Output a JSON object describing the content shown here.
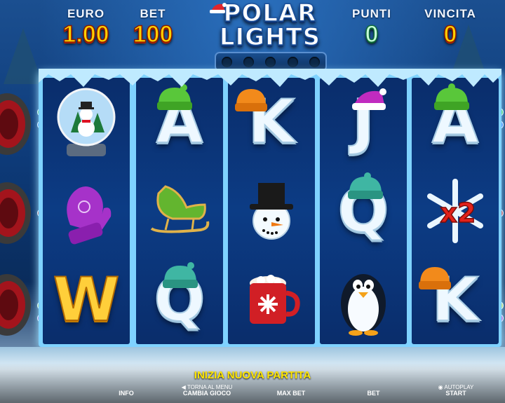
{
  "game": {
    "title_line1": "POLAR",
    "title_line2": "LIGHTS"
  },
  "stats": {
    "euro_label": "EURO",
    "euro_value": "1.00",
    "bet_label": "BET",
    "bet_value": "100",
    "points_label": "PUNTI",
    "points_value": "0",
    "win_label": "VINCITA",
    "win_value": "0"
  },
  "progress_dots": 5,
  "reels": [
    [
      "snow-globe-snowman",
      "purple-mitten",
      "W"
    ],
    [
      "A",
      "green-sleigh",
      "Q"
    ],
    [
      "K",
      "snowman-top-hat",
      "hot-cocoa-mug"
    ],
    [
      "J",
      "Q",
      "penguin"
    ],
    [
      "A",
      "snowflake-x2",
      "K"
    ]
  ],
  "symbols": {
    "multiplier_label": "x2"
  },
  "footer": {
    "new_game": "INIZIA NUOVA PARTITA",
    "info": "INFO",
    "menu_top": "TORNA AL MENU",
    "menu_bottom": "CAMBIA GIOCO",
    "max_bet": "MAX BET",
    "bet": "BET",
    "autoplay": "AUTOPLAY",
    "start": "START"
  },
  "colors": {
    "gold": "#ffd200",
    "accent": "#ffe600",
    "reel_bg": "#0c3c85",
    "ice": "#7fd2ff"
  }
}
